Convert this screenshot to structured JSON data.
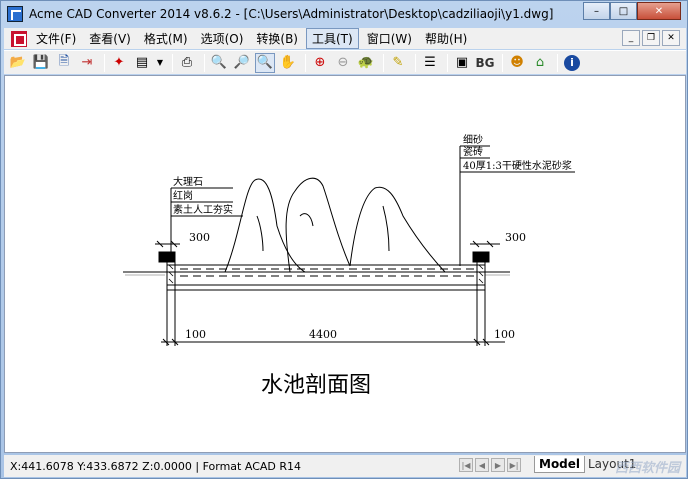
{
  "window": {
    "title": "Acme CAD Converter 2014 v8.6.2 - [C:\\Users\\Administrator\\Desktop\\cadziliaoji\\y1.dwg]",
    "controls": {
      "minimize": "–",
      "maximize": "□",
      "close": "✕"
    }
  },
  "menubar": {
    "items": [
      "文件(F)",
      "查看(V)",
      "格式(M)",
      "选项(O)",
      "转换(B)",
      "工具(T)",
      "窗口(W)",
      "帮助(H)"
    ],
    "active_index": 5,
    "mdi": {
      "minimize": "_",
      "restore": "❐",
      "close": "✕"
    }
  },
  "toolbar": {
    "icons": [
      "open-icon",
      "save-icon",
      "save-as-icon",
      "export-icon",
      "|",
      "acrobat-icon",
      "properties-icon",
      "dropdown-arrow-icon",
      "|",
      "print-icon",
      "|",
      "zoom-out-icon",
      "zoom-in-icon",
      "zoom-window-icon",
      "pan-icon",
      "|",
      "zoom-extents-icon",
      "zoom-disabled-icon",
      "turtle-icon",
      "|",
      "pen-icon",
      "|",
      "layers-icon",
      "|",
      "fit-icon",
      "bg-icon",
      "|",
      "help-icon",
      "home-icon",
      "|",
      "info-icon"
    ],
    "bg_label": "BG"
  },
  "drawing": {
    "left_label_1": "大理石",
    "left_label_2": "红岗",
    "left_label_3": "素土人工夯实",
    "right_label_1": "细砂",
    "right_label_2": "瓷砖",
    "right_label_3": "40厚1:3干硬性水泥砂浆",
    "dim_left_top": "300",
    "dim_right_top": "300",
    "dim_left_bottom": "100",
    "dim_middle_bottom": "4400",
    "dim_right_bottom": "100",
    "drawing_title": "水池剖面图"
  },
  "statusbar": {
    "coords": "X:441.6078 Y:433.6872 Z:0.0000 | Format ACAD R14",
    "nav": [
      "|◀",
      "◀",
      "▶",
      "▶|"
    ],
    "tab_model": "Model",
    "tab_layout": "Layout1",
    "watermark": "西西软件园"
  }
}
